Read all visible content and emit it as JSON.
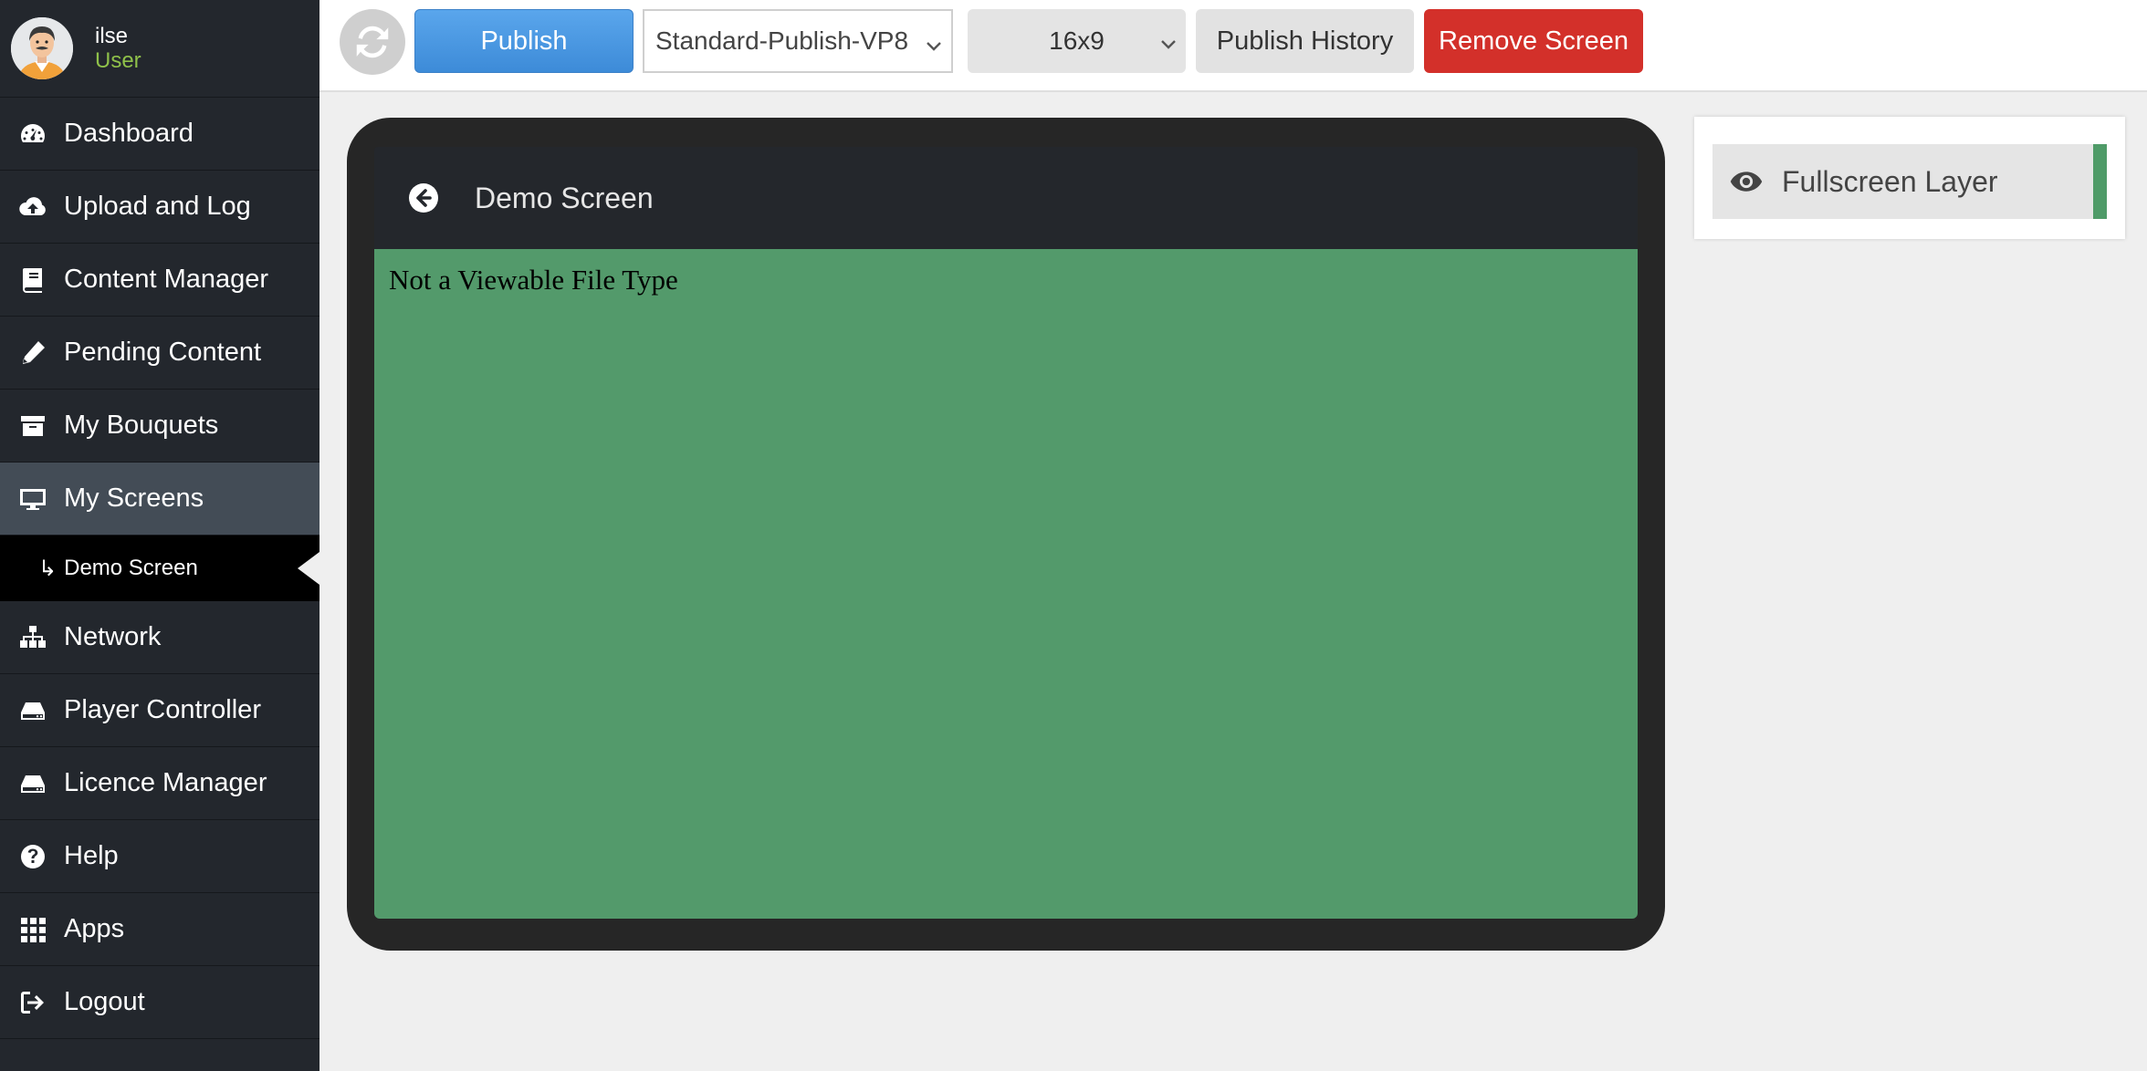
{
  "user": {
    "name": "ilse",
    "role": "User"
  },
  "sidebar": {
    "items": [
      {
        "label": "Dashboard",
        "icon": "dashboard-icon"
      },
      {
        "label": "Upload and Log",
        "icon": "cloud-upload-icon"
      },
      {
        "label": "Content Manager",
        "icon": "book-icon"
      },
      {
        "label": "Pending Content",
        "icon": "pencil-icon"
      },
      {
        "label": "My Bouquets",
        "icon": "archive-box-icon"
      },
      {
        "label": "My Screens",
        "icon": "monitor-icon",
        "active": true
      },
      {
        "label": "Network",
        "icon": "sitemap-icon"
      },
      {
        "label": "Player Controller",
        "icon": "hard-drive-icon"
      },
      {
        "label": "Licence Manager",
        "icon": "hard-drive-icon"
      },
      {
        "label": "Help",
        "icon": "question-circle-icon"
      },
      {
        "label": "Apps",
        "icon": "grid-icon"
      },
      {
        "label": "Logout",
        "icon": "sign-out-icon"
      }
    ],
    "sub_item": {
      "label": "Demo Screen",
      "arrow": "↳"
    }
  },
  "toolbar": {
    "publish_label": "Publish",
    "preset_value": "Standard-Publish-VP8",
    "ratio_value": "16x9",
    "history_label": "Publish History",
    "remove_label": "Remove Screen"
  },
  "screen": {
    "title": "Demo Screen",
    "message": "Not a Viewable File Type"
  },
  "layers": {
    "items": [
      {
        "label": "Fullscreen Layer",
        "color": "#4f9b68"
      }
    ]
  },
  "colors": {
    "sidebar_bg": "#23272d",
    "active_item": "#434c56",
    "publish_blue": "#3d8bd8",
    "remove_red": "#d3302a",
    "screen_green": "#539a6b",
    "role_green": "#8fc14a"
  }
}
